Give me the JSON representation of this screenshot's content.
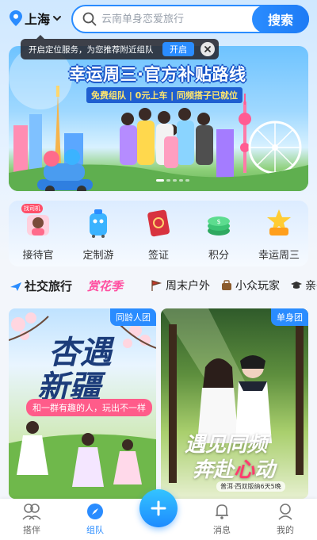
{
  "header": {
    "location": "上海",
    "search_placeholder": "云南单身恋爱旅行",
    "search_button": "搜索"
  },
  "location_tip": {
    "text": "开启定位服务，为您推荐附近组队",
    "open_button": "开启"
  },
  "banner": {
    "title": "幸运周三·官方补贴路线",
    "subtitle": "免费组队 | 0元上车 | 同频搭子已就位",
    "dot_count": 5,
    "active_dot": 0
  },
  "quick_menu": {
    "items": [
      {
        "label": "接待官",
        "badge": "找司机",
        "icon": "receptionist-icon"
      },
      {
        "label": "定制游",
        "icon": "custom-travel-icon"
      },
      {
        "label": "签证",
        "icon": "passport-icon"
      },
      {
        "label": "积分",
        "icon": "coins-icon"
      },
      {
        "label": "幸运周三",
        "icon": "lucky-wednesday-icon"
      }
    ]
  },
  "category_tabs": [
    {
      "label": "社交旅行",
      "icon": "plane-icon"
    },
    {
      "label": "赏花季",
      "icon": ""
    },
    {
      "label": "周末户外",
      "icon": "outdoor-icon"
    },
    {
      "label": "小众玩家",
      "icon": "suitcase-icon"
    },
    {
      "label": "亲子",
      "icon": "graduation-cap-icon"
    }
  ],
  "cards": [
    {
      "tag": "同龄人团",
      "title_line1": "杏遇",
      "title_line2": "新疆",
      "subtitle": "和一群有趣的人，玩出不一样"
    },
    {
      "tag": "单身团",
      "title_line1": "遇见同频",
      "title_line2a": "奔赴",
      "title_line2b": "心",
      "title_line2c": "动",
      "footer": "普洱·西双版纳6天5晚"
    }
  ],
  "bottom_nav": [
    {
      "label": "搭伴",
      "active": false
    },
    {
      "label": "组队",
      "active": true
    },
    {
      "label": "消息",
      "active": false
    },
    {
      "label": "我的",
      "active": false
    }
  ],
  "colors": {
    "accent": "#2a8cff",
    "tip_bg": "#28282f",
    "badge": "#ff4f6a"
  }
}
